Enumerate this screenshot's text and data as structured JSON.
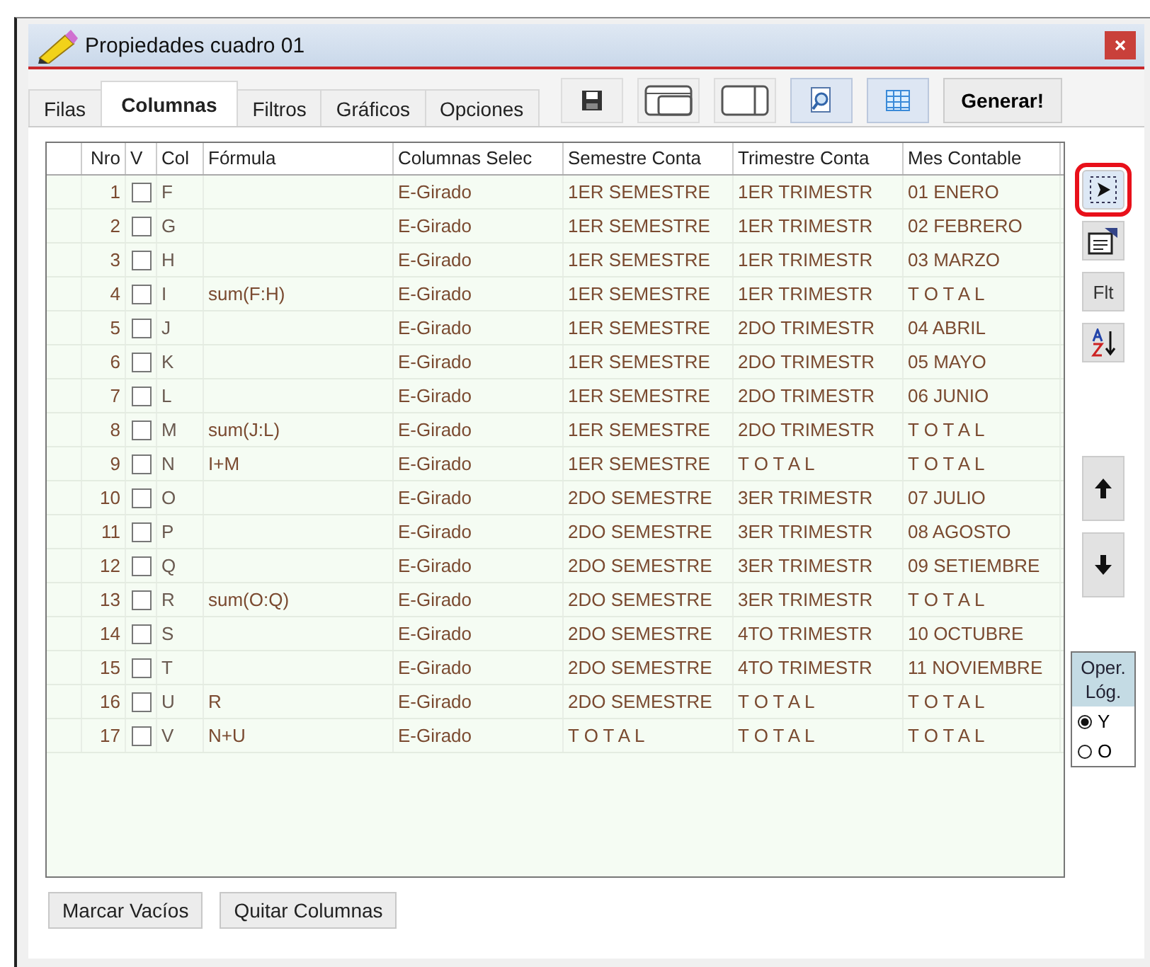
{
  "window": {
    "title": "Propiedades cuadro 01"
  },
  "tabs": [
    {
      "label": "Filas",
      "selected": false
    },
    {
      "label": "Columnas",
      "selected": true
    },
    {
      "label": "Filtros",
      "selected": false
    },
    {
      "label": "Gráficos",
      "selected": false
    },
    {
      "label": "Opciones",
      "selected": false
    }
  ],
  "toolbar": [
    {
      "kind": "save",
      "selected": false
    },
    {
      "kind": "layout",
      "selected": false
    },
    {
      "kind": "split",
      "selected": false
    },
    {
      "kind": "preview",
      "selected": true
    },
    {
      "kind": "grid",
      "selected": true
    }
  ],
  "generate_button": "Generar!",
  "table": {
    "columns": [
      "Nro",
      "V",
      "Col",
      "Fórmula",
      "Columnas Selec",
      "Semestre Conta",
      "Trimestre Conta",
      "Mes Contable"
    ],
    "rows": [
      {
        "nro": "1",
        "checked": false,
        "col": "F",
        "formula": "",
        "selection": "E-Girado",
        "semester": "1ER SEMESTRE",
        "quarter": "1ER TRIMESTR",
        "month": "01 ENERO"
      },
      {
        "nro": "2",
        "checked": false,
        "col": "G",
        "formula": "",
        "selection": "E-Girado",
        "semester": "1ER SEMESTRE",
        "quarter": "1ER TRIMESTR",
        "month": "02 FEBRERO"
      },
      {
        "nro": "3",
        "checked": false,
        "col": "H",
        "formula": "",
        "selection": "E-Girado",
        "semester": "1ER SEMESTRE",
        "quarter": "1ER TRIMESTR",
        "month": "03 MARZO"
      },
      {
        "nro": "4",
        "checked": false,
        "col": "I",
        "formula": "sum(F:H)",
        "selection": "E-Girado",
        "semester": "1ER SEMESTRE",
        "quarter": "1ER TRIMESTR",
        "month": "T O T A L"
      },
      {
        "nro": "5",
        "checked": false,
        "col": "J",
        "formula": "",
        "selection": "E-Girado",
        "semester": "1ER SEMESTRE",
        "quarter": "2DO TRIMESTR",
        "month": "04 ABRIL"
      },
      {
        "nro": "6",
        "checked": false,
        "col": "K",
        "formula": "",
        "selection": "E-Girado",
        "semester": "1ER SEMESTRE",
        "quarter": "2DO TRIMESTR",
        "month": "05 MAYO"
      },
      {
        "nro": "7",
        "checked": false,
        "col": "L",
        "formula": "",
        "selection": "E-Girado",
        "semester": "1ER SEMESTRE",
        "quarter": "2DO TRIMESTR",
        "month": "06 JUNIO"
      },
      {
        "nro": "8",
        "checked": false,
        "col": "M",
        "formula": "sum(J:L)",
        "selection": "E-Girado",
        "semester": "1ER SEMESTRE",
        "quarter": "2DO TRIMESTR",
        "month": "T O T A L"
      },
      {
        "nro": "9",
        "checked": false,
        "col": "N",
        "formula": "I+M",
        "selection": "E-Girado",
        "semester": "1ER SEMESTRE",
        "quarter": "T O T A L",
        "month": "T O T A L"
      },
      {
        "nro": "10",
        "checked": false,
        "col": "O",
        "formula": "",
        "selection": "E-Girado",
        "semester": "2DO SEMESTRE",
        "quarter": "3ER TRIMESTR",
        "month": "07 JULIO"
      },
      {
        "nro": "11",
        "checked": false,
        "col": "P",
        "formula": "",
        "selection": "E-Girado",
        "semester": "2DO SEMESTRE",
        "quarter": "3ER TRIMESTR",
        "month": "08 AGOSTO"
      },
      {
        "nro": "12",
        "checked": false,
        "col": "Q",
        "formula": "",
        "selection": "E-Girado",
        "semester": "2DO SEMESTRE",
        "quarter": "3ER TRIMESTR",
        "month": "09 SETIEMBRE"
      },
      {
        "nro": "13",
        "checked": false,
        "col": "R",
        "formula": "sum(O:Q)",
        "selection": "E-Girado",
        "semester": "2DO SEMESTRE",
        "quarter": "3ER TRIMESTR",
        "month": "T O T A L"
      },
      {
        "nro": "14",
        "checked": false,
        "col": "S",
        "formula": "",
        "selection": "E-Girado",
        "semester": "2DO SEMESTRE",
        "quarter": "4TO TRIMESTR",
        "month": "10 OCTUBRE"
      },
      {
        "nro": "15",
        "checked": false,
        "col": "T",
        "formula": "",
        "selection": "E-Girado",
        "semester": "2DO SEMESTRE",
        "quarter": "4TO TRIMESTR",
        "month": "11 NOVIEMBRE"
      },
      {
        "nro": "16",
        "checked": false,
        "col": "U",
        "formula": "R",
        "selection": "E-Girado",
        "semester": "2DO SEMESTRE",
        "quarter": "T O T A L",
        "month": "T O T A L"
      },
      {
        "nro": "17",
        "checked": false,
        "col": "V",
        "formula": "N+U",
        "selection": "E-Girado",
        "semester": "T O T A L",
        "quarter": "T O T A L",
        "month": "T O T A L"
      }
    ]
  },
  "side_buttons": [
    {
      "kind": "select",
      "highlighted": true
    },
    {
      "kind": "properties",
      "highlighted": false
    },
    {
      "kind": "text",
      "label": "Flt",
      "highlighted": false
    },
    {
      "kind": "sort",
      "highlighted": false
    },
    {
      "kind": "up",
      "highlighted": false
    },
    {
      "kind": "down",
      "highlighted": false
    }
  ],
  "logic_panel": {
    "title_lines": [
      "Oper.",
      "Lóg."
    ],
    "options": [
      {
        "label": "Y",
        "selected": true
      },
      {
        "label": "O",
        "selected": false
      }
    ]
  },
  "bottom_buttons": [
    "Marcar Vacíos",
    "Quitar Columnas"
  ]
}
